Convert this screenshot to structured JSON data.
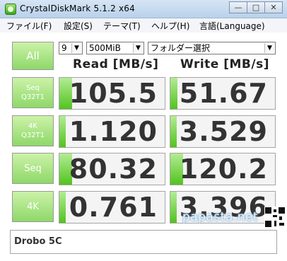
{
  "window": {
    "title": "CrystalDiskMark 5.1.2 x64",
    "minimize": "—",
    "maximize": "□",
    "close": "✕"
  },
  "menu": [
    "ファイル(F)",
    "設定(S)",
    "テーマ(T)",
    "ヘルプ(H)",
    "言語(Language)"
  ],
  "controls": {
    "all_label": "All",
    "count": "9",
    "size": "500MiB",
    "drive": "フォルダー選択"
  },
  "headers": {
    "read": "Read [MB/s]",
    "write": "Write [MB/s]"
  },
  "rows": [
    {
      "label_line1": "Seq",
      "label_line2": "Q32T1",
      "read": "105.5",
      "write": "51.67",
      "read_fill": 0.12,
      "write_fill": 0.07
    },
    {
      "label_line1": "4K",
      "label_line2": "Q32T1",
      "read": "1.120",
      "write": "3.529",
      "read_fill": 0.06,
      "write_fill": 0.06
    },
    {
      "label_line1": "Seq",
      "label_line2": "",
      "read": "80.32",
      "write": "120.2",
      "read_fill": 0.12,
      "write_fill": 0.12
    },
    {
      "label_line1": "4K",
      "label_line2": "",
      "read": "0.761",
      "write": "3.396",
      "read_fill": 0.06,
      "write_fill": 0.06
    }
  ],
  "comment": "Drobo 5C",
  "watermark": "papasta.net",
  "icons": {
    "app": "crystaldiskmark-icon",
    "dropdown": "chevron-down-icon"
  }
}
